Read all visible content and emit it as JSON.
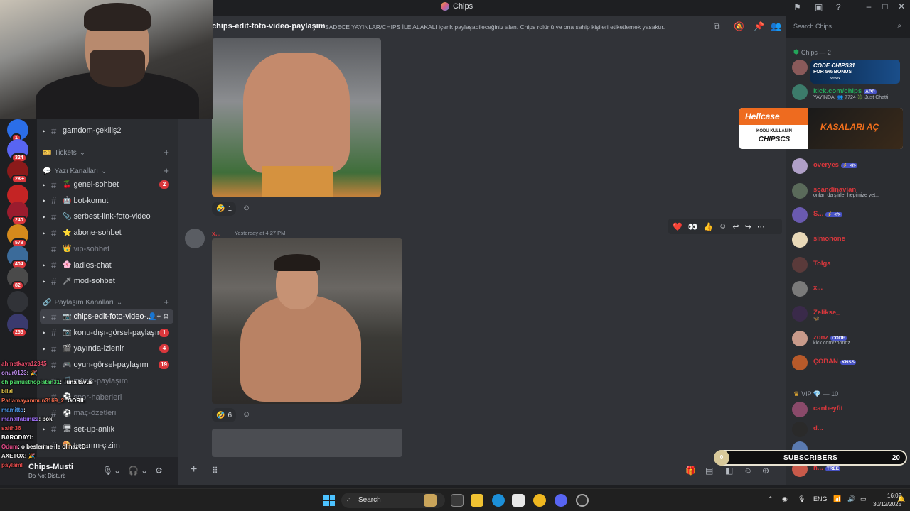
{
  "window": {
    "title": "Chips"
  },
  "header": {
    "channel_name": "chips-edit-foto-video-paylaşım",
    "topic": "SADECE YAYINLAR/CHIPS İLE ALAKALI içerik paylaşabileceğiniz alan. Chips rolünü ve ona sahip kişileri etiketlemek yasaktır.",
    "search_placeholder": "Search Chips"
  },
  "servers": [
    {
      "badge": "1",
      "color": "#2b6ee8"
    },
    {
      "badge": "324",
      "color": "#5865f2"
    },
    {
      "badge": "2K+",
      "color": "#8b1a1a"
    },
    {
      "badge": "",
      "color": "#c42424"
    },
    {
      "badge": "240",
      "color": "#9b1c2e"
    },
    {
      "badge": "578",
      "color": "#d48a1c"
    },
    {
      "badge": "404",
      "color": "#3b6b9a"
    },
    {
      "badge": "82",
      "color": "#4a4a4a"
    },
    {
      "badge": "",
      "color": "#313338"
    },
    {
      "badge": "255",
      "color": "#3a3a6e"
    }
  ],
  "sidebar": {
    "top_channel": "gamdom-çekiliş2",
    "categories": {
      "tickets": "Tickets",
      "text": "Yazı Kanalları",
      "share": "Paylaşım Kanalları"
    },
    "text_channels": [
      {
        "emoji": "🍒",
        "label": "genel-sohbet",
        "badge": "2"
      },
      {
        "emoji": "🤖",
        "label": "bot-komut",
        "badge": ""
      },
      {
        "emoji": "📎",
        "label": "serbest-link-foto-video",
        "badge": ""
      },
      {
        "emoji": "⭐",
        "label": "abone-sohbet",
        "badge": ""
      },
      {
        "emoji": "👑",
        "label": "vip-sohbet",
        "badge": ""
      },
      {
        "emoji": "🌸",
        "label": "ladies-chat",
        "badge": ""
      },
      {
        "emoji": "🗡",
        "label": "mod-sohbet",
        "badge": ""
      }
    ],
    "share_channels": [
      {
        "emoji": "📷",
        "label": "chips-edit-foto-video-...",
        "badge": ""
      },
      {
        "emoji": "📷",
        "label": "konu-dışı-görsel-paylaşım",
        "badge": "1"
      },
      {
        "emoji": "🎬",
        "label": "yayında-izlenir",
        "badge": "4"
      },
      {
        "emoji": "🎮",
        "label": "oyun-görsel-paylaşım",
        "badge": "19"
      },
      {
        "emoji": "🎵",
        "label": "müzik-paylaşım",
        "badge": ""
      },
      {
        "emoji": "⚽",
        "label": "spor-haberleri",
        "badge": ""
      },
      {
        "emoji": "⚽",
        "label": "maç-özetleri",
        "badge": ""
      },
      {
        "emoji": "🖥",
        "label": "set-up-anlık",
        "badge": ""
      },
      {
        "emoji": "🎨",
        "label": "tasarım-çizim",
        "badge": ""
      }
    ]
  },
  "user": {
    "name": "Chips-Musti",
    "status": "Do Not Disturb"
  },
  "chat_overlay": [
    {
      "user": "ahmetkaya12345",
      "text": "",
      "color": "#e84c6b"
    },
    {
      "user": "onur0123",
      "text": ": 🎉",
      "color": "#c08cf0"
    },
    {
      "user": "chipsmusthoplatan31",
      "text": ": Tuna tavus",
      "color": "#4fdc6a"
    },
    {
      "user": "bilal",
      "text": "",
      "color": "#f0d04c"
    },
    {
      "user": "Patlamayanmun3169_2",
      "text": ": GORIL",
      "color": "#f06a4c"
    },
    {
      "user": "mamitto",
      "text": ":",
      "color": "#4c9bf0"
    },
    {
      "user": "manalfabinizz",
      "text": ": bok",
      "color": "#9b6cf0"
    },
    {
      "user": "saith36",
      "text": "",
      "color": "#e84c4c"
    },
    {
      "user": "BARODAYI",
      "text": ":",
      "color": "#ffffff"
    },
    {
      "user": "Odum",
      "text": ": o beslenme ile olmaz :D",
      "color": "#e84c8b"
    },
    {
      "user": "AXETOX",
      "text": ": 🎉",
      "color": "#f0f0f0"
    },
    {
      "user": "paylaml",
      "text": "",
      "color": "#e84c4c"
    }
  ],
  "messages": [
    {
      "reaction": {
        "emoji": "🤣",
        "count": "1"
      }
    },
    {
      "author": "x...",
      "timestamp": "Yesterday at 4:27 PM",
      "reaction": {
        "emoji": "🤣",
        "count": "6"
      }
    }
  ],
  "hover_actions": [
    "❤️",
    "👀",
    "👍",
    "☺",
    "↩",
    "↪",
    "⋯"
  ],
  "members": {
    "online_header": "Chips — 2",
    "online": [
      {
        "name": "Chips",
        "sub": "",
        "color": "#da373c"
      },
      {
        "name": "kick.com/chips",
        "tag": "APP",
        "sub": "YAYINDA! 👥 7724 ❇️ Just Chatti",
        "color": "#23a55a"
      },
      {
        "name": "kairos",
        "sub": "◀",
        "color": "#da373c"
      },
      {
        "name": "L...",
        "sub": "",
        "color": "#da373c"
      },
      {
        "name": "overyes",
        "tag": "⚡ </>",
        "sub": "",
        "color": "#da373c"
      },
      {
        "name": "scandinavian",
        "sub": "onları da şiirler hepimize yet...",
        "color": "#da373c"
      },
      {
        "name": "S...",
        "tag": "⚡ </>",
        "sub": "",
        "color": "#da373c"
      },
      {
        "name": "simonone",
        "sub": "",
        "color": "#da373c"
      },
      {
        "name": "Tolga",
        "sub": "",
        "color": "#da373c"
      },
      {
        "name": "x...",
        "sub": "",
        "color": "#da373c"
      },
      {
        "name": "Zelikse_",
        "sub": "🦋",
        "color": "#da373c"
      },
      {
        "name": "zonz",
        "tag": "CODE",
        "sub": "kick.com/zhonnz",
        "color": "#da373c"
      },
      {
        "name": "ÇOBAN",
        "tag": "KNSS",
        "sub": "",
        "color": "#da373c"
      }
    ],
    "vip_header": "VIP 💎 — 10",
    "vip": [
      {
        "name": "canbeyfit",
        "sub": "",
        "color": "#da373c"
      },
      {
        "name": "d...",
        "sub": "",
        "color": "#da373c"
      },
      {
        "name": "",
        "sub": "Slowmode immune",
        "color": "#da373c"
      },
      {
        "name": "h...",
        "tag": "TREE",
        "sub": "",
        "color": "#da373c"
      }
    ]
  },
  "ads": {
    "code_ad": {
      "line1": "CODE CHIPS31",
      "line2": "FOR 5% BONUS",
      "line3": "Lootbox"
    },
    "hellcase": {
      "brand": "Hellcase",
      "kodu": "KODU KULLANIN",
      "code": "CHIPSCS",
      "cta": "KASALARI AÇ"
    }
  },
  "subscribers": {
    "current": "0",
    "label": "SUBSCRIBERS",
    "goal": "20"
  },
  "taskbar": {
    "search": "Search",
    "lang": "ENG",
    "time": "16:02",
    "date": "30/12/2025"
  },
  "colors": {
    "accent": "#5865f2",
    "danger": "#da373c",
    "online": "#23a55a"
  }
}
